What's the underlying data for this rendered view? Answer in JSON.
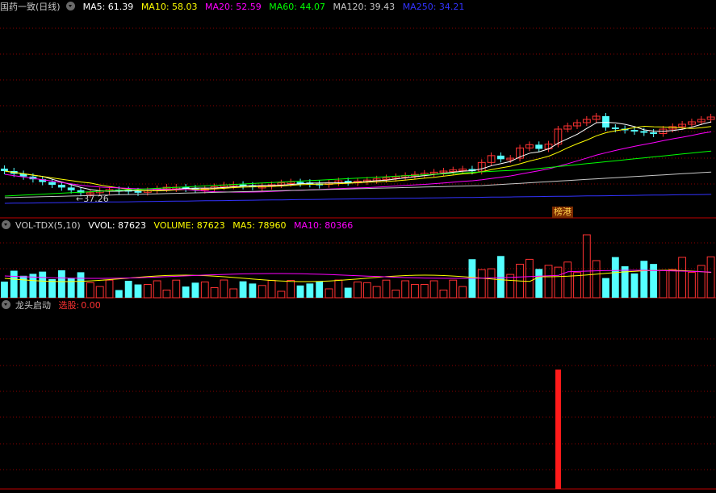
{
  "price_panel": {
    "title": "国药一致(日线)",
    "indicators": [
      {
        "label": "MA5: 61.39",
        "color": "#ffffff"
      },
      {
        "label": "MA10: 58.03",
        "color": "#ffff00"
      },
      {
        "label": "MA20: 52.59",
        "color": "#ff00ff"
      },
      {
        "label": "MA60: 44.07",
        "color": "#00ff00"
      },
      {
        "label": "MA120: 39.43",
        "color": "#c8c8c8"
      },
      {
        "label": "MA250: 34.21",
        "color": "#3333ff"
      }
    ],
    "low_marker": "←37.26",
    "tag": "榜港"
  },
  "volume_panel": {
    "title": "VOL-TDX(5,10)",
    "indicators": [
      {
        "label": "VVOL: 87623",
        "color": "#ffffff"
      },
      {
        "label": "VOLUME: 87623",
        "color": "#ffff00"
      },
      {
        "label": "MA5: 78960",
        "color": "#ffff00"
      },
      {
        "label": "MA10: 80366",
        "color": "#ff00ff"
      }
    ]
  },
  "signal_panel": {
    "title": "龙头启动",
    "label": "选股:",
    "value": "0.00"
  },
  "colors": {
    "up": "#ff3232",
    "down": "#54ffff",
    "grid": "#8b0000",
    "bg": "#000000"
  }
}
